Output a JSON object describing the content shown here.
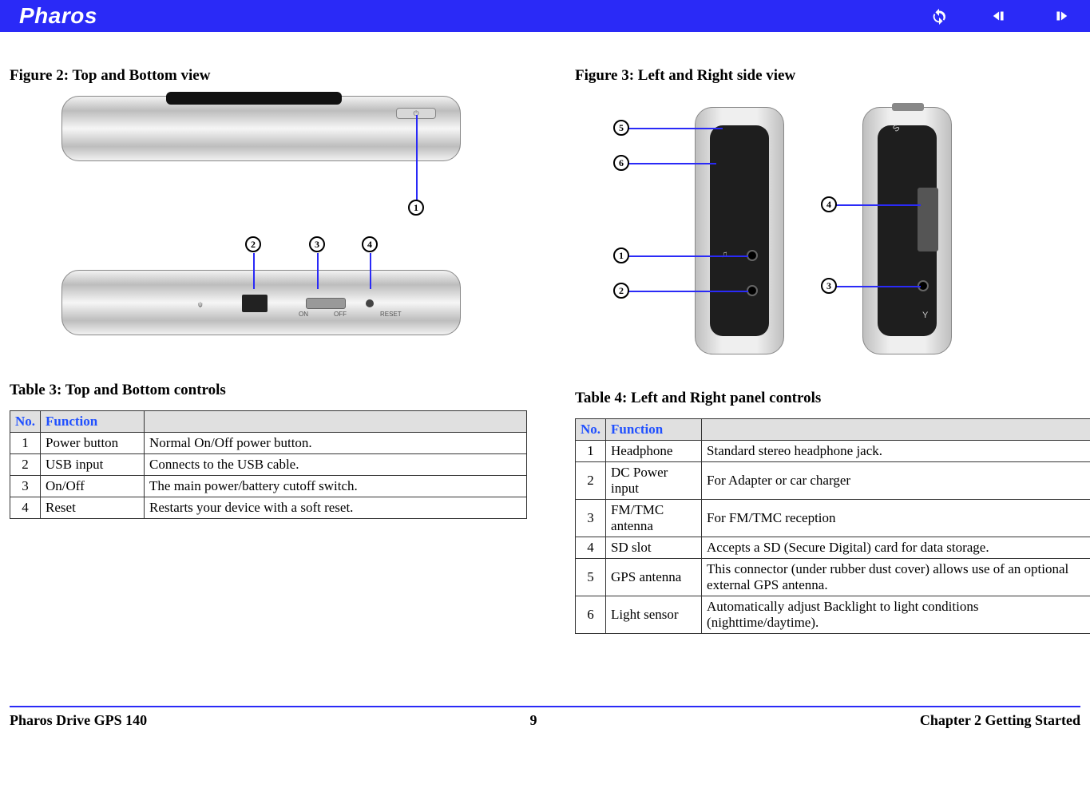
{
  "header": {
    "brand": "Pharos"
  },
  "left": {
    "figure_title": "Figure 2: Top and Bottom view",
    "table_title": "Table 3: Top and Bottom controls",
    "callouts": {
      "c1": "1",
      "c2": "2",
      "c3": "3",
      "c4": "4"
    },
    "labels": {
      "on": "ON",
      "off": "OFF",
      "reset": "RESET",
      "usb_sym": "ψ",
      "pwr_sym": "⏻"
    },
    "table": {
      "h_no": "No.",
      "h_fn": "Function",
      "rows": [
        {
          "no": "1",
          "fn": "Power button",
          "desc": "Normal On/Off power button."
        },
        {
          "no": "2",
          "fn": "USB input",
          "desc": "Connects to the USB cable."
        },
        {
          "no": "3",
          "fn": "On/Off",
          "desc": "The main power/battery cutoff switch."
        },
        {
          "no": "4",
          "fn": "Reset",
          "desc": "Restarts your device with a soft reset."
        }
      ]
    }
  },
  "right": {
    "figure_title": "Figure 3: Left and Right side view",
    "table_title": "Table 4: Left and Right panel controls",
    "callouts": {
      "c1": "1",
      "c2": "2",
      "c3": "3",
      "c4": "4",
      "c5": "5",
      "c6": "6"
    },
    "labels": {
      "hp": "♫",
      "ant": "Y",
      "sd": "S"
    },
    "table": {
      "h_no": "No.",
      "h_fn": "Function",
      "rows": [
        {
          "no": "1",
          "fn": "Headphone",
          "desc": "Standard stereo headphone jack."
        },
        {
          "no": "2",
          "fn": "DC Power input",
          "desc": "For Adapter or car charger"
        },
        {
          "no": "3",
          "fn": "FM/TMC antenna",
          "desc": "For FM/TMC reception"
        },
        {
          "no": "4",
          "fn": "SD slot",
          "desc": "Accepts a SD (Secure Digital) card for data storage."
        },
        {
          "no": "5",
          "fn": "GPS antenna",
          "desc": "This connector (under rubber dust cover) allows use of an optional external GPS antenna."
        },
        {
          "no": "6",
          "fn": "Light sensor",
          "desc": "Automatically adjust Backlight to light conditions (nighttime/daytime)."
        }
      ]
    }
  },
  "footer": {
    "left": "Pharos Drive GPS 140",
    "center": "9",
    "right": "Chapter 2 Getting Started"
  }
}
